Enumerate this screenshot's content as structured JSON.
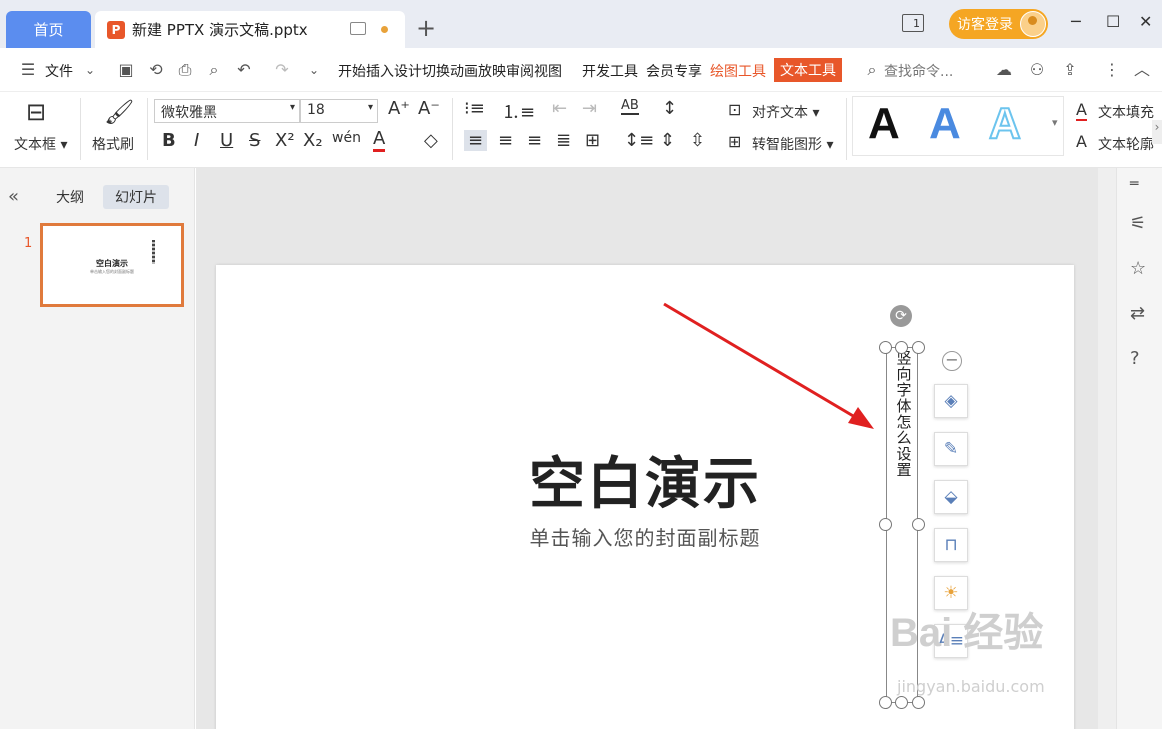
{
  "titlebar": {
    "home_tab": "首页",
    "doc_tab": "新建 PPTX 演示文稿.pptx",
    "doc_icon_letter": "P",
    "window_count": "1",
    "login_label": "访客登录"
  },
  "menubar": {
    "file_label": "文件",
    "tabs": [
      "开始",
      "插入",
      "设计",
      "切换",
      "动画",
      "放映",
      "审阅",
      "视图",
      "开发工具",
      "会员专享"
    ],
    "drawing_tools": "绘图工具",
    "text_tools": "文本工具",
    "search_placeholder": "查找命令..."
  },
  "ribbon": {
    "textbox_label": "文本框",
    "format_painter_label": "格式刷",
    "font_name": "微软雅黑",
    "font_size": "18",
    "align_text_label": "对齐文本",
    "smart_shape_label": "转智能图形",
    "text_fill_label": "文本填充",
    "text_outline_label": "文本轮廓",
    "wordart_letter": "A",
    "colors": {
      "accent": "#e8572a",
      "wordart_blue": "#4a8ae0",
      "wordart_light": "#6cc4ee"
    }
  },
  "leftpane": {
    "outline_tab": "大纲",
    "slides_tab": "幻灯片",
    "slide_number": "1",
    "thumb_title": "空白演示",
    "thumb_subtitle": "单击输入您的封面副标题"
  },
  "slide": {
    "title": "空白演示",
    "subtitle": "单击输入您的封面副标题",
    "vertical_text": "竖向字体怎么设置"
  },
  "watermark": {
    "logo": "Bai 经验",
    "url": "jingyan.baidu.com"
  }
}
